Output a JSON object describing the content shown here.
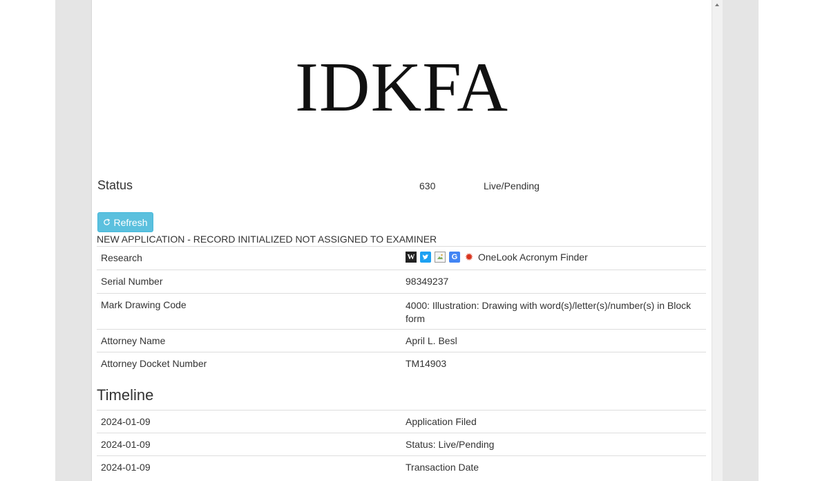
{
  "mark": {
    "text": "IDKFA"
  },
  "status": {
    "label": "Status",
    "code": "630",
    "text": "Live/Pending",
    "description": "NEW APPLICATION - RECORD INITIALIZED NOT ASSIGNED TO EXAMINER"
  },
  "refresh": {
    "label": "Refresh"
  },
  "research": {
    "label": "Research",
    "icons": [
      "wikipedia-icon",
      "twitter-icon",
      "broken-image-icon",
      "google-translate-icon",
      "onelook-burst-icon"
    ],
    "onelook_label": "OneLook Acronym Finder"
  },
  "details": [
    {
      "label": "Serial Number",
      "value": "98349237"
    },
    {
      "label": "Mark Drawing Code",
      "value": "4000: Illustration: Drawing with word(s)/letter(s)/number(s) in Block form"
    },
    {
      "label": "Attorney Name",
      "value": "April L. Besl"
    },
    {
      "label": "Attorney Docket Number",
      "value": "TM14903"
    }
  ],
  "timeline": {
    "heading": "Timeline",
    "rows": [
      {
        "date": "2024-01-09",
        "event": "Application Filed"
      },
      {
        "date": "2024-01-09",
        "event": "Status: Live/Pending"
      },
      {
        "date": "2024-01-09",
        "event": "Transaction Date"
      }
    ]
  },
  "colors": {
    "refresh_button": "#5bc0de",
    "row_border": "#dddddd",
    "side_gutter": "#e5e5e5"
  }
}
